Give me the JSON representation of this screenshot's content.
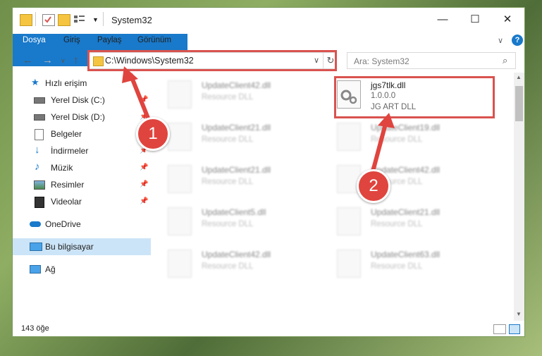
{
  "window": {
    "title": "System32",
    "minimize_glyph": "—",
    "maximize_glyph": "☐",
    "close_glyph": "✕",
    "help_glyph": "?",
    "expand_glyph": "∨"
  },
  "ribbon": {
    "tabs": [
      "Dosya",
      "Giriş",
      "Paylaş",
      "Görünüm"
    ]
  },
  "address": {
    "path": "C:\\Windows\\System32",
    "search_placeholder": "Ara: System32"
  },
  "sidebar": {
    "items": [
      {
        "label": "Hızlı erişim",
        "icon": "star-icon"
      },
      {
        "label": "Yerel Disk (C:)",
        "icon": "drive-icon"
      },
      {
        "label": "Yerel Disk (D:)",
        "icon": "drive-icon"
      },
      {
        "label": "Belgeler",
        "icon": "documents-icon"
      },
      {
        "label": "İndirmeler",
        "icon": "download-icon"
      },
      {
        "label": "Müzik",
        "icon": "music-icon"
      },
      {
        "label": "Resimler",
        "icon": "pictures-icon"
      },
      {
        "label": "Videolar",
        "icon": "video-icon"
      },
      {
        "label": "OneDrive",
        "icon": "cloud-icon"
      },
      {
        "label": "Bu bilgisayar",
        "icon": "computer-icon"
      },
      {
        "label": "Ağ",
        "icon": "network-icon"
      }
    ]
  },
  "files": [
    {
      "name": "UpdateClient42.dll",
      "desc": "Resource DLL"
    },
    {
      "name": "jgs7tlk.dll",
      "version": "1.0.0.0",
      "desc": "JG ART DLL"
    },
    {
      "name": "UpdateClient21.dll",
      "desc": "Resource DLL"
    },
    {
      "name": "UpdateClient19.dll",
      "desc": "Resource DLL"
    },
    {
      "name": "UpdateClient21.dll",
      "desc": "Resource DLL"
    },
    {
      "name": "UpdateClient42.dll",
      "desc": "Resource DLL"
    },
    {
      "name": "UpdateClient5.dll",
      "desc": "Resource DLL"
    },
    {
      "name": "UpdateClient21.dll",
      "desc": "Resource DLL"
    },
    {
      "name": "UpdateClient42.dll",
      "desc": "Resource DLL"
    },
    {
      "name": "UpdateClient63.dll",
      "desc": "Resource DLL"
    }
  ],
  "status": {
    "count": "143 öğe"
  },
  "annotations": {
    "step1": "1",
    "step2": "2"
  },
  "colors": {
    "accent": "#1979ca",
    "highlight": "#d9534f",
    "arrow": "#e0443e"
  }
}
